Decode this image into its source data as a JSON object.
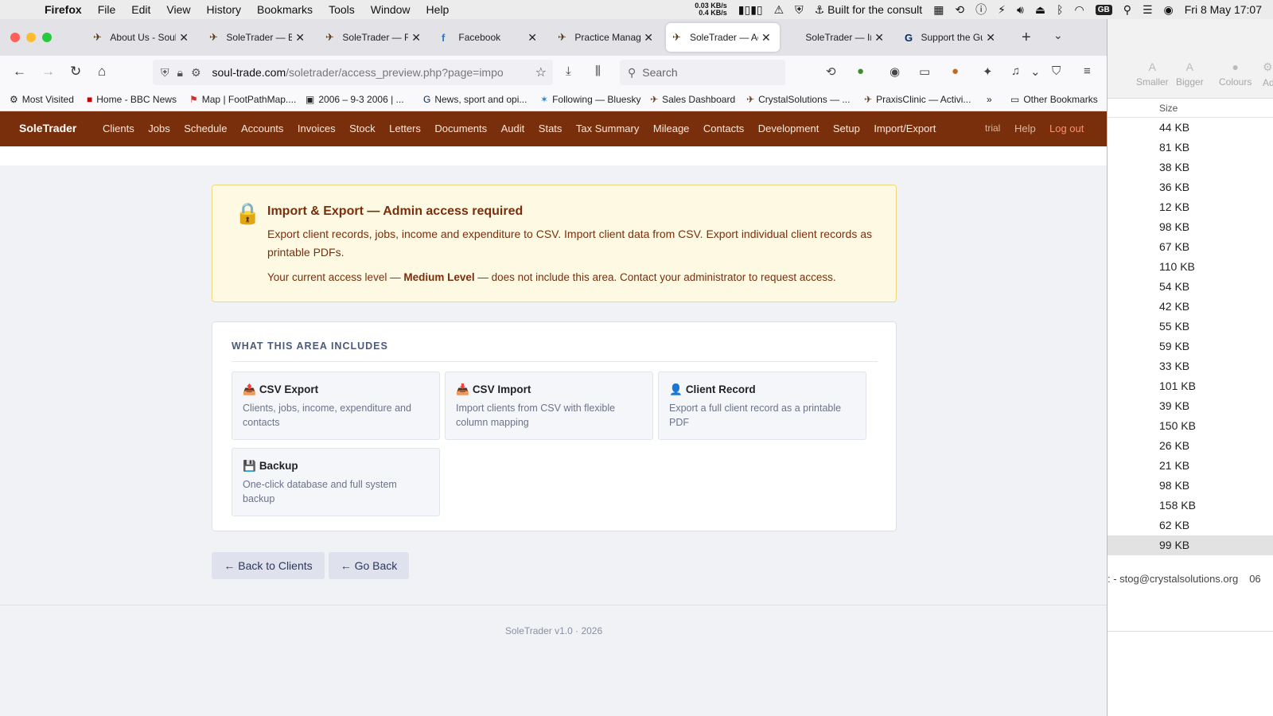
{
  "menubar": {
    "app": "Firefox",
    "items": [
      "File",
      "Edit",
      "View",
      "History",
      "Bookmarks",
      "Tools",
      "Window",
      "Help"
    ],
    "net_up": "0.03 KB/s",
    "net_down": "0.4 KB/s",
    "status_text": "Built for the consult",
    "keyboard": "GB",
    "datetime": "Fri 8 May  17:07"
  },
  "tabs": [
    {
      "title": "About Us - SoulT",
      "icon": "soletrader-logo-icon"
    },
    {
      "title": "SoleTrader — Bu",
      "icon": "soletrader-logo-icon"
    },
    {
      "title": "SoleTrader — Fe",
      "icon": "soletrader-logo-icon"
    },
    {
      "title": "Facebook",
      "icon": "facebook-icon"
    },
    {
      "title": "Practice Manage",
      "icon": "soletrader-logo-icon"
    },
    {
      "title": "SoleTrader — Acc",
      "icon": "soletrader-logo-icon",
      "active": true
    },
    {
      "title": "SoleTrader — Installa",
      "icon": ""
    },
    {
      "title": "Support the Gua",
      "icon": "guardian-icon"
    }
  ],
  "urlbar": {
    "domain": "soul-trade.com",
    "path": "/soletrader/access_preview.php?page=impo",
    "search_placeholder": "Search"
  },
  "bookmarks": [
    "Most Visited",
    "Home - BBC News",
    "Map | FootPathMap....",
    "2006 – 9-3 2006 | ...",
    "News, sport and opi...",
    "Following — Bluesky",
    "Sales Dashboard",
    "CrystalSolutions — ...",
    "PraxisClinic — Activi...",
    "Other Bookmarks"
  ],
  "app": {
    "brand": "SoleTrader",
    "nav": [
      "Clients",
      "Jobs",
      "Schedule",
      "Accounts",
      "Invoices",
      "Stock",
      "Letters",
      "Documents",
      "Audit",
      "Stats",
      "Tax Summary",
      "Mileage",
      "Contacts",
      "Development",
      "Setup",
      "Import/Export"
    ],
    "trial": "trial",
    "help": "Help",
    "logout": "Log out"
  },
  "alert": {
    "title": "Import & Export — Admin access required",
    "description": "Export client records, jobs, income and expenditure to CSV. Import client data from CSV. Export individual client records as printable PDFs.",
    "level_prefix": "Your current access level — ",
    "level": "Medium Level",
    "level_suffix": " — does not include this area. Contact your administrator to request access."
  },
  "includes": {
    "heading": "WHAT THIS AREA INCLUDES",
    "cards": [
      {
        "icon": "outbox-tray-icon",
        "glyph": "📤",
        "title": "CSV Export",
        "desc": "Clients, jobs, income, expenditure and contacts"
      },
      {
        "icon": "inbox-tray-icon",
        "glyph": "📥",
        "title": "CSV Import",
        "desc": "Import clients from CSV with flexible column mapping"
      },
      {
        "icon": "user-silhouette-icon",
        "glyph": "👤",
        "title": "Client Record",
        "desc": "Export a full client record as a printable PDF"
      },
      {
        "icon": "floppy-disk-icon",
        "glyph": "💾",
        "title": "Backup",
        "desc": "One-click database and full system backup"
      }
    ]
  },
  "buttons": {
    "back_clients": "← Back to Clients",
    "go_back": "← Go Back"
  },
  "footer": "SoleTrader v1.0  ·  2026",
  "background_app": {
    "tools": [
      "Smaller",
      "Bigger",
      "Colours",
      "Add Se"
    ],
    "column": "Size",
    "sizes": [
      "44 KB",
      "81 KB",
      "38 KB",
      "36 KB",
      "12 KB",
      "98 KB",
      "67 KB",
      "110 KB",
      "54 KB",
      "42 KB",
      "55 KB",
      "59 KB",
      "33 KB",
      "101 KB",
      "39 KB",
      "150 KB",
      "26 KB",
      "21 KB",
      "98 KB",
      "158 KB",
      "62 KB",
      "99 KB"
    ],
    "email": ": - stog@crystalsolutions.org",
    "date_fragment": "06"
  }
}
